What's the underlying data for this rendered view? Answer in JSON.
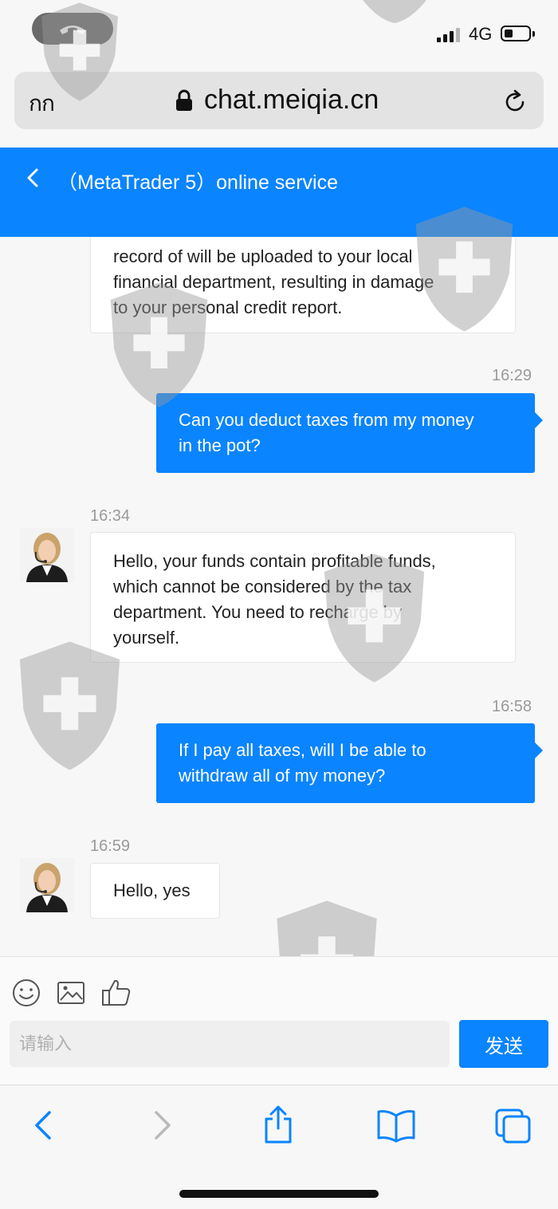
{
  "status_bar": {
    "network": "4G",
    "battery_level": 0.35,
    "call_icon": "phone-hangup-icon"
  },
  "browser": {
    "text_size_label": "กก",
    "url": "chat.meiqia.cn",
    "lock_icon": "lock-icon",
    "reload_icon": "reload-icon"
  },
  "header": {
    "title": "（MetaTrader 5）online service",
    "back_icon": "chevron-left-icon"
  },
  "messages": [
    {
      "from": "agent",
      "lines": [
        "record of will be uploaded to your local",
        "financial department, resulting in damage",
        "to your personal credit report."
      ]
    },
    {
      "from": "user",
      "time": "16:29",
      "lines": [
        "Can you deduct taxes from my money",
        "in the pot?"
      ]
    },
    {
      "from": "agent",
      "time": "16:34",
      "lines": [
        "Hello, your funds contain profitable funds,",
        "which cannot be considered by the tax",
        "department. You need to recharge by",
        "yourself."
      ]
    },
    {
      "from": "user",
      "time": "16:58",
      "lines": [
        "If I pay all taxes, will I be able to",
        "withdraw all of my money?"
      ]
    },
    {
      "from": "agent",
      "time": "16:59",
      "lines": [
        "Hello, yes"
      ]
    }
  ],
  "composer": {
    "placeholder": "请输入",
    "send_label": "发送",
    "tools": [
      "emoji-icon",
      "image-icon",
      "thumbs-up-icon"
    ]
  },
  "safari_toolbar": {
    "icons": [
      "back-arrow-icon",
      "forward-arrow-icon",
      "share-icon",
      "bookmarks-icon",
      "tabs-icon"
    ]
  },
  "colors": {
    "accent": "#0a84ff",
    "background": "#f7f7f7",
    "agent_bubble": "#ffffff",
    "timestamp": "#9a9a9a"
  }
}
